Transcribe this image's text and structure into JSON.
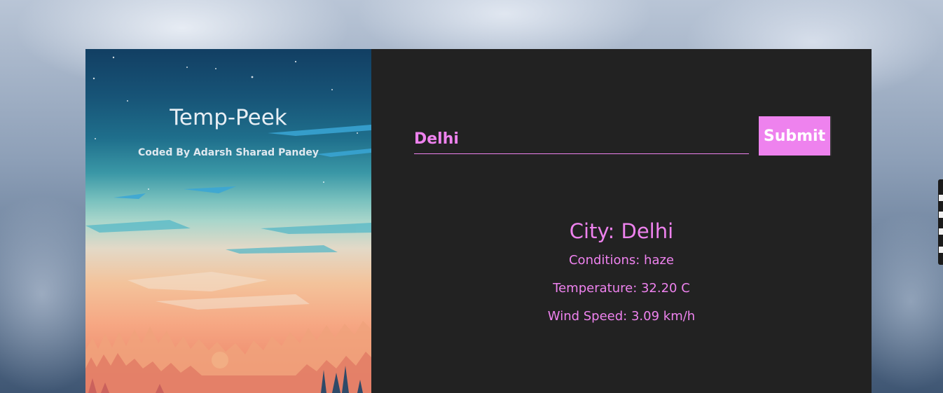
{
  "app": {
    "title": "Temp-Peek",
    "credit": "Coded By Adarsh Sharad Pandey"
  },
  "search": {
    "value": "Delhi",
    "placeholder": "",
    "submit_label": "Submit"
  },
  "result": {
    "city": "City: Delhi",
    "conditions": "Conditions: haze",
    "temperature": "Temperature: 32.20 C",
    "wind_speed": "Wind Speed: 3.09 km/h"
  },
  "colors": {
    "accent": "#ee82ee",
    "panel_bg": "#222222"
  },
  "icons": [
    "cloudy-sky-background",
    "sunset-forest-illustration"
  ]
}
